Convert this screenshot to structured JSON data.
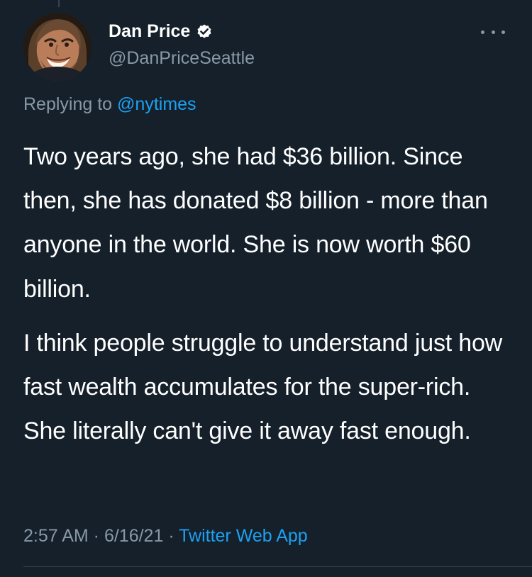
{
  "tweet": {
    "author": {
      "name": "Dan Price",
      "handle": "@DanPriceSeattle",
      "verified_icon": "verified-badge-icon",
      "avatar_icon": "profile-avatar"
    },
    "replying_to": {
      "prefix": "Replying to ",
      "mention": "@nytimes"
    },
    "paragraphs": [
      "Two years ago, she had $36 billion. Since then, she has donated $8 billion - more than anyone in the world. She is now worth $60 billion.",
      "I think people struggle to understand just how fast wealth accumulates for the super-rich. She literally can't give it away fast enough."
    ],
    "meta": {
      "time": "2:57 AM",
      "separator_1": " · ",
      "date": "6/16/21",
      "separator_2": " · ",
      "app": "Twitter Web App"
    },
    "more_icon": "more-horizontal-icon"
  },
  "colors": {
    "background": "#15202b",
    "primary_text": "#ffffff",
    "secondary_text": "#8899a6",
    "accent": "#1da1f2",
    "divider": "#38444d"
  }
}
